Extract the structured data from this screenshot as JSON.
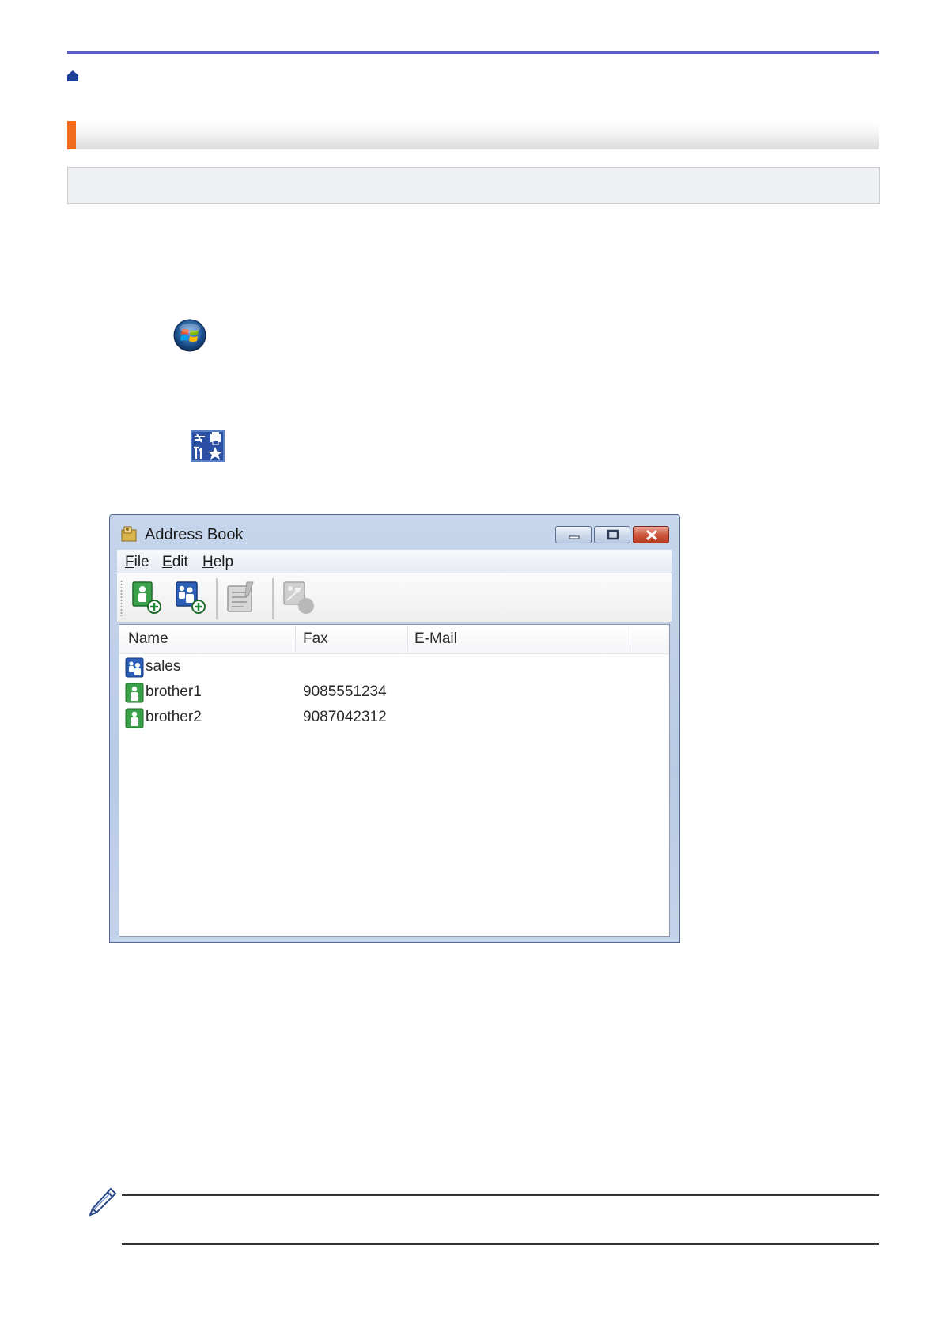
{
  "icons": {
    "home": "home-icon",
    "start": "windows-start-orb-icon",
    "tools": "brother-utilities-tools-icon",
    "note": "pencil-note-icon"
  },
  "colors": {
    "header_rule": "#5b5fc7",
    "title_accent": "#f26a1b",
    "home_icon": "#1d3f9a"
  },
  "window": {
    "title": "Address Book",
    "menu": [
      {
        "label": "File",
        "accel": "F",
        "rest": "ile"
      },
      {
        "label": "Edit",
        "accel": "E",
        "rest": "dit"
      },
      {
        "label": "Help",
        "accel": "H",
        "rest": "elp"
      }
    ],
    "toolbar": [
      "add-member-icon",
      "add-group-icon",
      "edit-icon",
      "delete-icon"
    ],
    "columns": [
      "Name",
      "Fax",
      "E-Mail"
    ],
    "rows": [
      {
        "type": "group",
        "name": "sales",
        "fax": "",
        "email": ""
      },
      {
        "type": "member",
        "name": "brother1",
        "fax": "9085551234",
        "email": ""
      },
      {
        "type": "member",
        "name": "brother2",
        "fax": "9087042312",
        "email": ""
      }
    ]
  }
}
